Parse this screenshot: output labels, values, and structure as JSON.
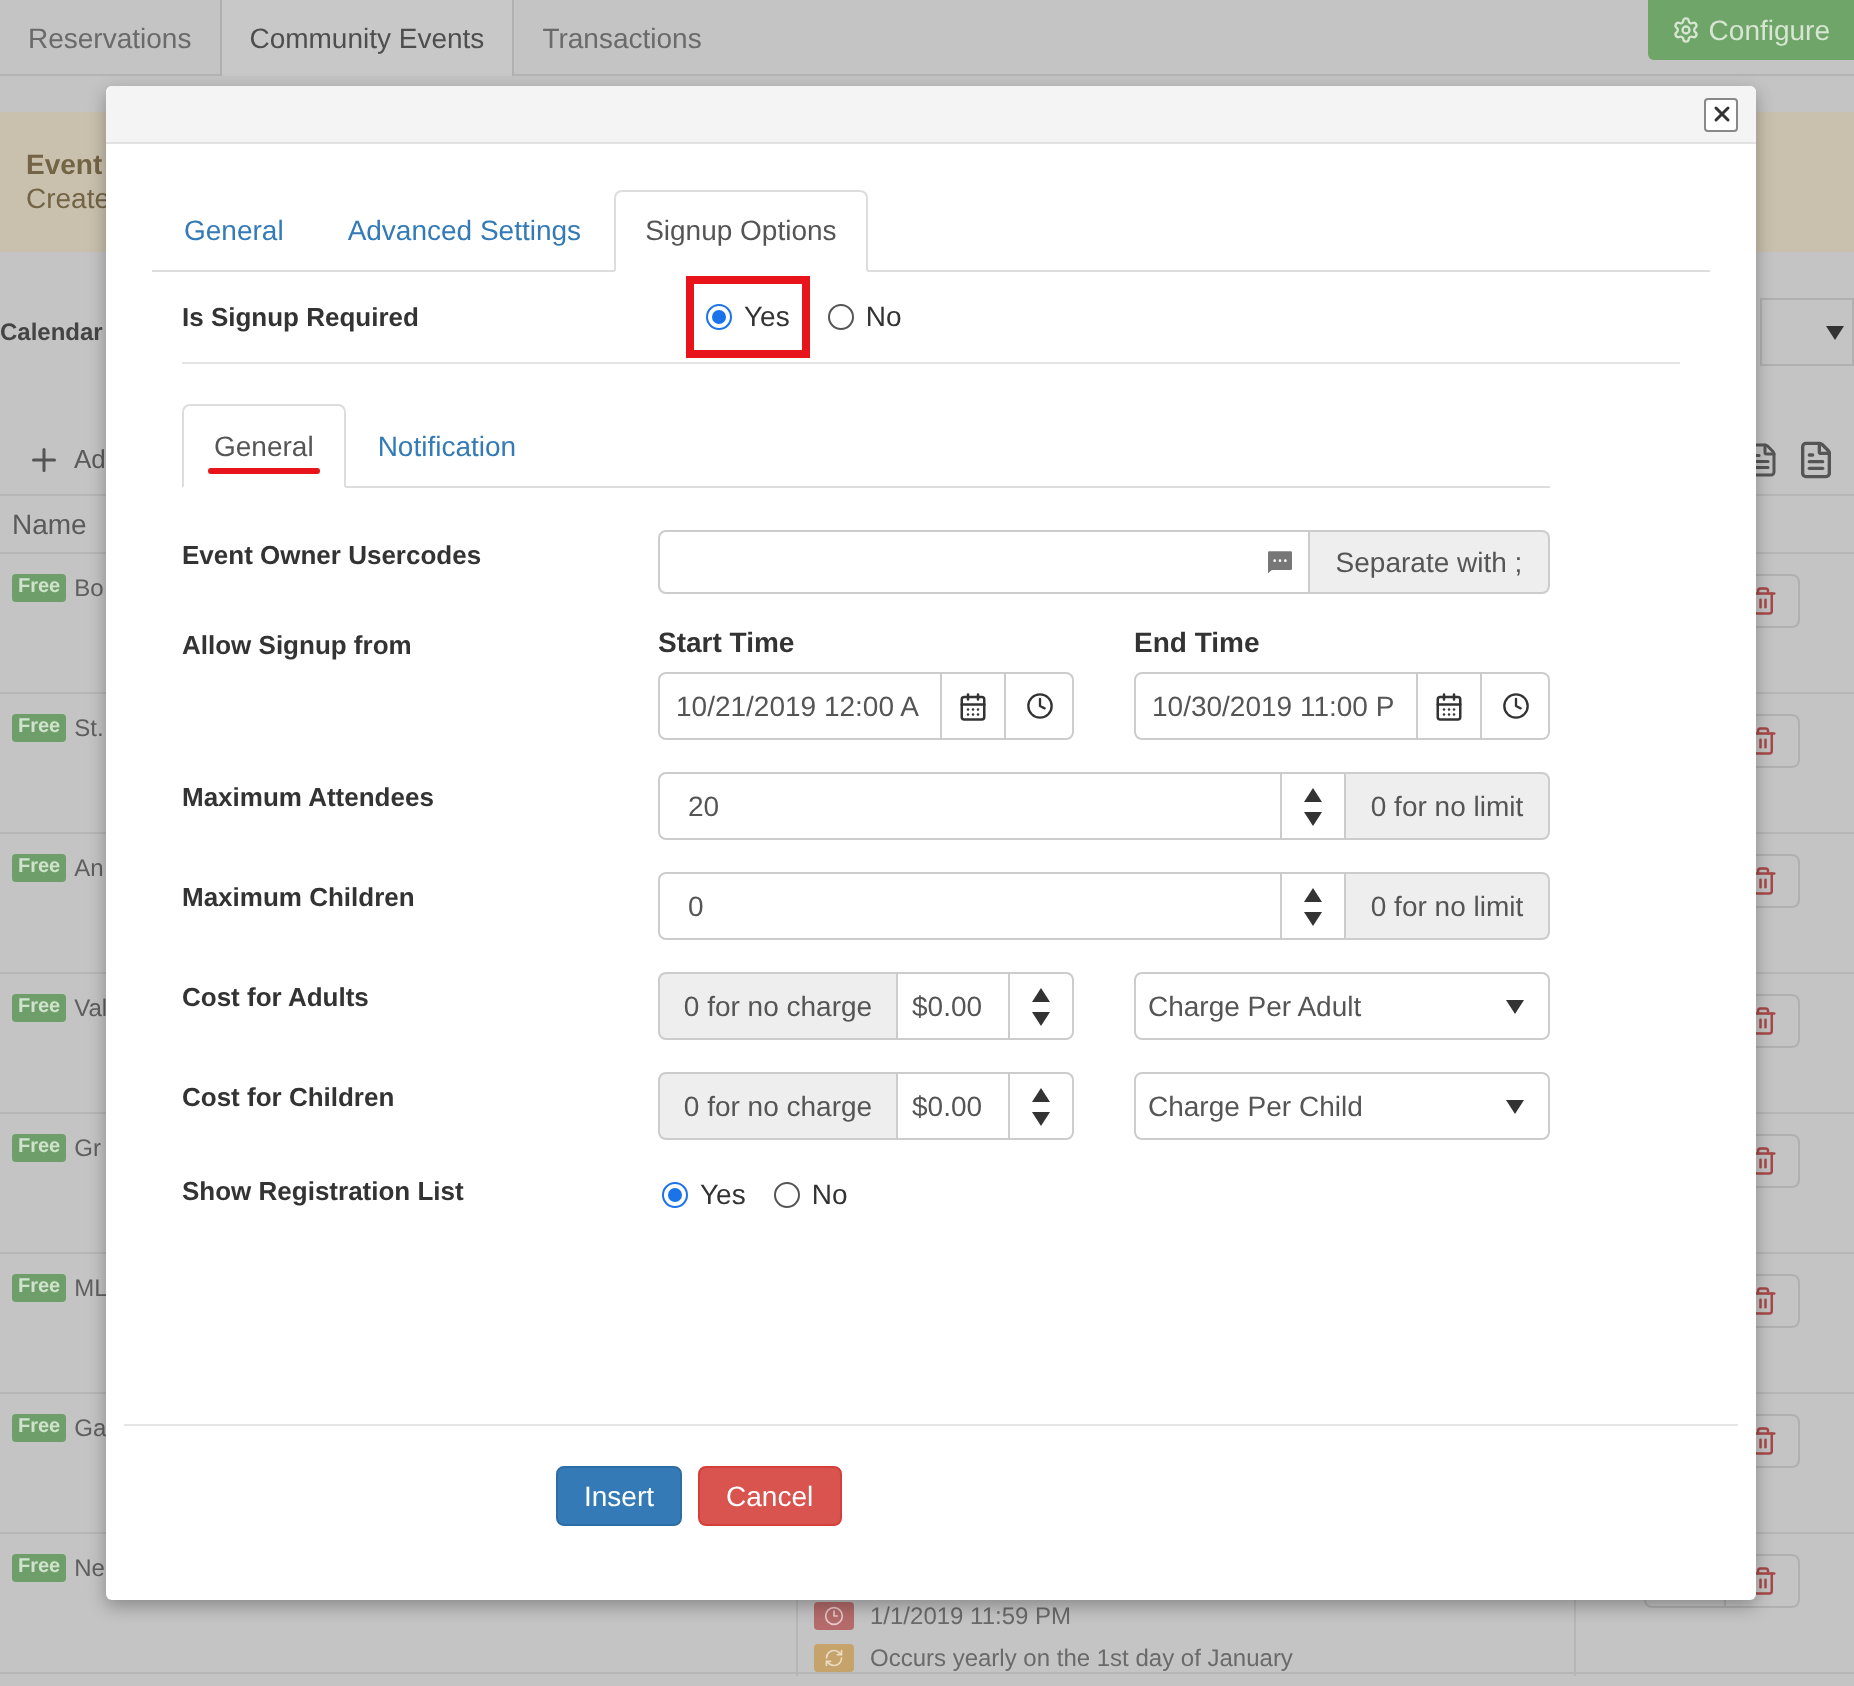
{
  "background": {
    "tabs": [
      {
        "label": "Reservations",
        "selected": false
      },
      {
        "label": "Community Events",
        "selected": true
      },
      {
        "label": "Transactions",
        "selected": false
      }
    ],
    "configure_button": "Configure",
    "banner": {
      "title": "Event",
      "text": "Create"
    },
    "calendar_label": "Calendar",
    "add_button": "Ad",
    "name_header": "Name",
    "rows": [
      {
        "badge": "Free",
        "name": "Bo"
      },
      {
        "badge": "Free",
        "name": "St."
      },
      {
        "badge": "Free",
        "name": "An"
      },
      {
        "badge": "Free",
        "name": "Val"
      },
      {
        "badge": "Free",
        "name": "Gr"
      },
      {
        "badge": "Free",
        "name": "ML"
      },
      {
        "badge": "Free",
        "name": "Ga"
      },
      {
        "badge": "Free",
        "name": "Ne",
        "time": "1/1/2019 11:59 PM",
        "recurrence": "Occurs yearly on the 1st day of January"
      }
    ]
  },
  "dialog": {
    "tabs": [
      {
        "label": "General",
        "selected": false
      },
      {
        "label": "Advanced Settings",
        "selected": false
      },
      {
        "label": "Signup Options",
        "selected": true
      }
    ],
    "signup_required": {
      "label": "Is Signup Required",
      "highlighted": true,
      "options": [
        {
          "label": "Yes",
          "selected": true
        },
        {
          "label": "No",
          "selected": false
        }
      ]
    },
    "subtabs": [
      {
        "label": "General",
        "selected": true
      },
      {
        "label": "Notification",
        "selected": false
      }
    ],
    "fields": [
      {
        "kind": "addon-input",
        "label": "Event Owner Usercodes",
        "addon": "Separate with ;"
      },
      {
        "kind": "datetime-range",
        "label": "Allow Signup from",
        "start": {
          "label": "Start Time",
          "value": "10/21/2019 12:00 A"
        },
        "end": {
          "label": "End Time",
          "value": "10/30/2019 11:00 P"
        }
      },
      {
        "kind": "number",
        "label": "Maximum Attendees",
        "value": "20",
        "addon": "0 for no limit"
      },
      {
        "kind": "number",
        "label": "Maximum Children",
        "value": "0",
        "addon": "0 for no limit"
      },
      {
        "kind": "cost",
        "label": "Cost for Adults",
        "addon": "0 for no charge",
        "value": "$0.00",
        "select": "Charge Per Adult"
      },
      {
        "kind": "cost",
        "label": "Cost for Children",
        "addon": "0 for no charge",
        "value": "$0.00",
        "select": "Charge Per Child"
      },
      {
        "kind": "radio",
        "label": "Show Registration List",
        "options": [
          {
            "label": "Yes",
            "selected": true
          },
          {
            "label": "No",
            "selected": false
          }
        ]
      }
    ],
    "buttons": [
      {
        "label": "Insert",
        "kind": "primary"
      },
      {
        "label": "Cancel",
        "kind": "danger"
      }
    ]
  }
}
